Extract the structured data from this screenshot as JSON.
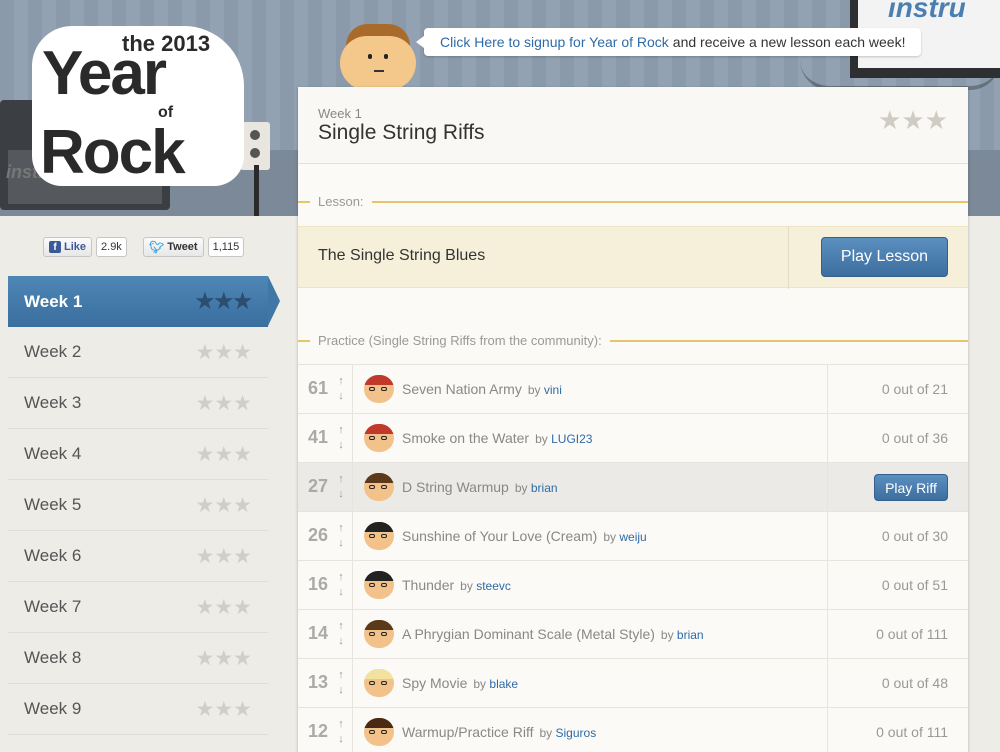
{
  "header": {
    "logo_the": "the 2013",
    "logo_year": "Year",
    "logo_of": "of",
    "logo_rock": "Rock",
    "amp_brand": "instru",
    "tv_brand": "instru",
    "signup_link": "Click Here to signup for Year of Rock",
    "signup_rest": "and receive a new lesson each week!"
  },
  "social": {
    "like_label": "Like",
    "like_count": "2.9k",
    "tweet_label": "Tweet",
    "tweet_count": "1,115"
  },
  "sidebar": {
    "weeks": [
      {
        "label": "Week 1",
        "stars": "★★★",
        "active": true
      },
      {
        "label": "Week 2",
        "stars": "★★★"
      },
      {
        "label": "Week 3",
        "stars": "★★★"
      },
      {
        "label": "Week 4",
        "stars": "★★★"
      },
      {
        "label": "Week 5",
        "stars": "★★★"
      },
      {
        "label": "Week 6",
        "stars": "★★★"
      },
      {
        "label": "Week 7",
        "stars": "★★★"
      },
      {
        "label": "Week 8",
        "stars": "★★★"
      },
      {
        "label": "Week 9",
        "stars": "★★★"
      }
    ]
  },
  "panel": {
    "week": "Week 1",
    "title": "Single String Riffs",
    "stars": "★★★",
    "lesson_section": "Lesson:",
    "lesson_name": "The Single String Blues",
    "play_lesson": "Play Lesson",
    "practice_section": "Practice (Single String Riffs from the community):"
  },
  "riffs": [
    {
      "score": "61",
      "title": "Seven Nation Army",
      "by": "by",
      "user": "vini",
      "progress": "0 out of 21",
      "hair": "#c0392b"
    },
    {
      "score": "41",
      "title": "Smoke on the Water",
      "by": "by",
      "user": "LUGI23",
      "progress": "0 out of 36",
      "hair": "#c0392b"
    },
    {
      "score": "27",
      "title": "D String Warmup",
      "by": "by",
      "user": "brian",
      "play": "Play Riff",
      "hl": true,
      "hair": "#5a3a1a"
    },
    {
      "score": "26",
      "title": "Sunshine of Your Love (Cream)",
      "by": "by",
      "user": "weiju",
      "progress": "0 out of 30",
      "hair": "#222222"
    },
    {
      "score": "16",
      "title": "Thunder",
      "by": "by",
      "user": "steevc",
      "progress": "0 out of 51",
      "hair": "#222222"
    },
    {
      "score": "14",
      "title": "A Phrygian Dominant Scale (Metal Style)",
      "by": "by",
      "user": "brian",
      "progress": "0 out of 111",
      "hair": "#5a3a1a"
    },
    {
      "score": "13",
      "title": "Spy Movie",
      "by": "by",
      "user": "blake",
      "progress": "0 out of 48",
      "hair": "#f2e2a0"
    },
    {
      "score": "12",
      "title": "Warmup/Practice Riff",
      "by": "by",
      "user": "Siguros",
      "progress": "0 out of 111",
      "hair": "#4a2a12"
    }
  ]
}
